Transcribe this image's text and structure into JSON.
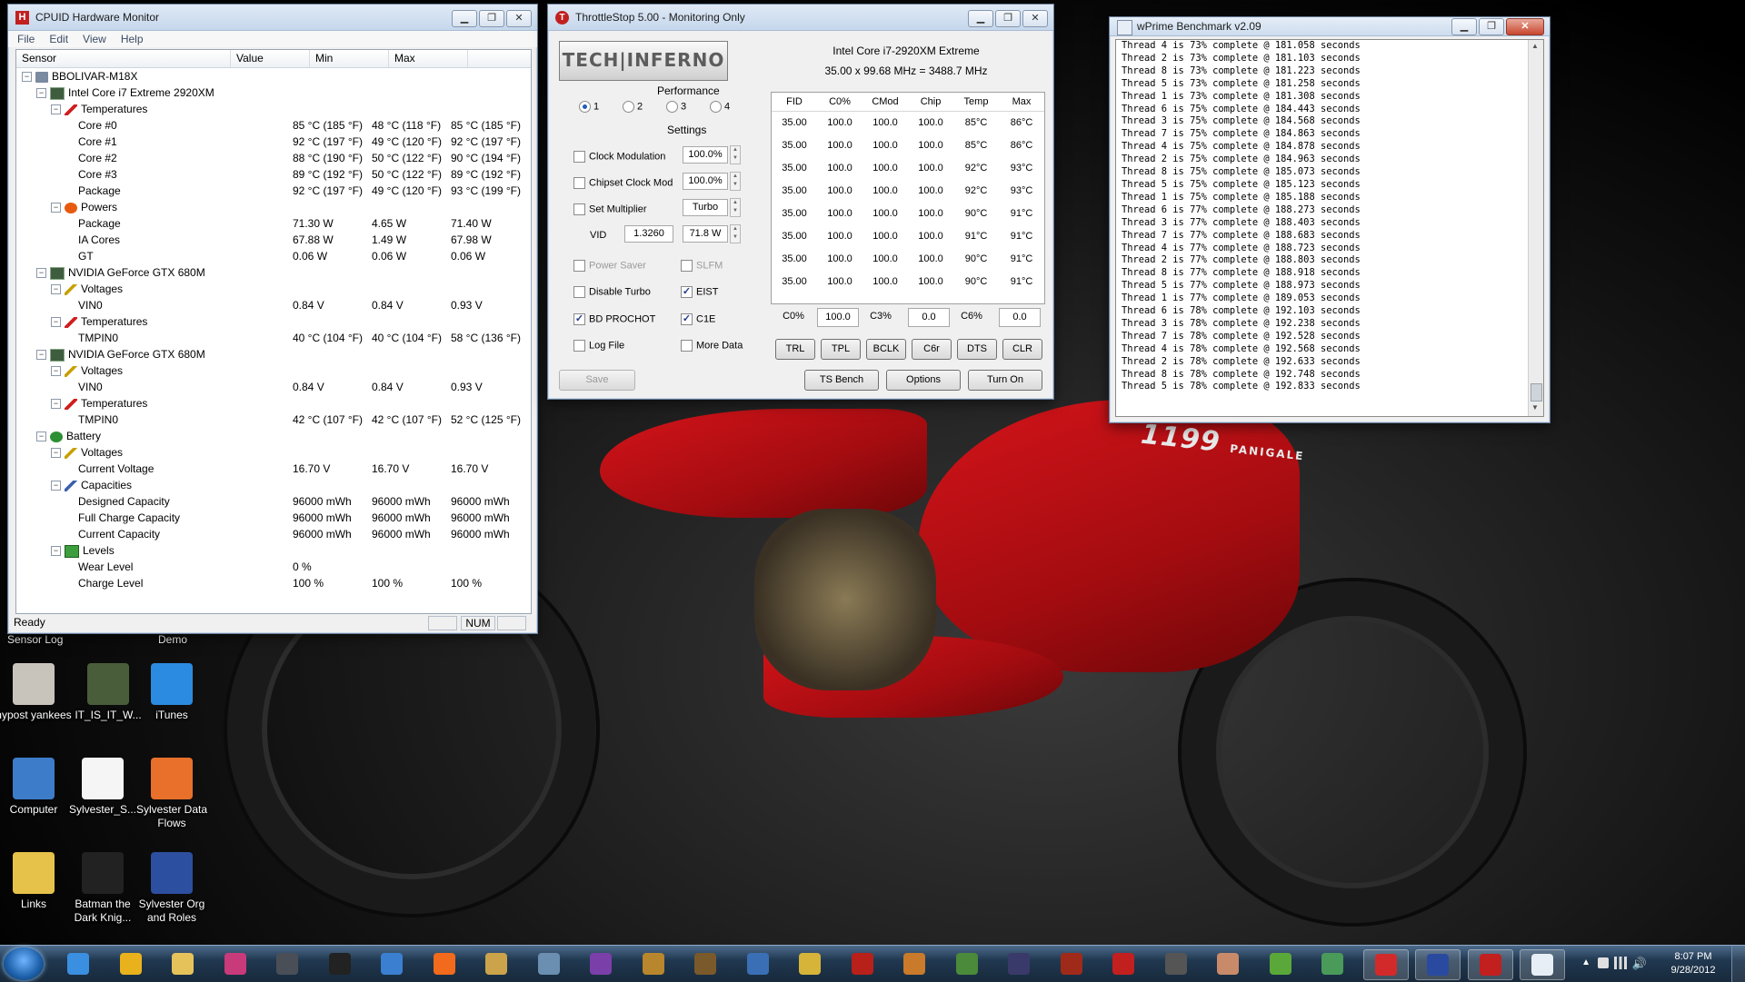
{
  "hwm": {
    "title": "CPUID Hardware Monitor",
    "menu": [
      "File",
      "Edit",
      "View",
      "Help"
    ],
    "columns": [
      "Sensor",
      "Value",
      "Min",
      "Max"
    ],
    "status": "Ready",
    "num": "NUM",
    "rows": [
      {
        "indent": 0,
        "exp": "−",
        "icon": "pc",
        "label": "BBOLIVAR-M18X",
        "v": "",
        "mn": "",
        "mx": ""
      },
      {
        "indent": 1,
        "exp": "−",
        "icon": "chip",
        "label": "Intel Core i7 Extreme 2920XM",
        "v": "",
        "mn": "",
        "mx": ""
      },
      {
        "indent": 2,
        "exp": "−",
        "icon": "therm",
        "label": "Temperatures",
        "v": "",
        "mn": "",
        "mx": ""
      },
      {
        "indent": 3,
        "exp": "",
        "icon": "",
        "label": "Core #0",
        "v": "85 °C  (185 °F)",
        "mn": "48 °C  (118 °F)",
        "mx": "85 °C  (185 °F)"
      },
      {
        "indent": 3,
        "exp": "",
        "icon": "",
        "label": "Core #1",
        "v": "92 °C  (197 °F)",
        "mn": "49 °C  (120 °F)",
        "mx": "92 °C  (197 °F)"
      },
      {
        "indent": 3,
        "exp": "",
        "icon": "",
        "label": "Core #2",
        "v": "88 °C  (190 °F)",
        "mn": "50 °C  (122 °F)",
        "mx": "90 °C  (194 °F)"
      },
      {
        "indent": 3,
        "exp": "",
        "icon": "",
        "label": "Core #3",
        "v": "89 °C  (192 °F)",
        "mn": "50 °C  (122 °F)",
        "mx": "89 °C  (192 °F)"
      },
      {
        "indent": 3,
        "exp": "",
        "icon": "",
        "label": "Package",
        "v": "92 °C  (197 °F)",
        "mn": "49 °C  (120 °F)",
        "mx": "93 °C  (199 °F)"
      },
      {
        "indent": 2,
        "exp": "−",
        "icon": "bolt",
        "label": "Powers",
        "v": "",
        "mn": "",
        "mx": ""
      },
      {
        "indent": 3,
        "exp": "",
        "icon": "",
        "label": "Package",
        "v": "71.30 W",
        "mn": "4.65 W",
        "mx": "71.40 W"
      },
      {
        "indent": 3,
        "exp": "",
        "icon": "",
        "label": "IA Cores",
        "v": "67.88 W",
        "mn": "1.49 W",
        "mx": "67.98 W"
      },
      {
        "indent": 3,
        "exp": "",
        "icon": "",
        "label": "GT",
        "v": "0.06 W",
        "mn": "0.06 W",
        "mx": "0.06 W"
      },
      {
        "indent": 1,
        "exp": "−",
        "icon": "chip",
        "label": "NVIDIA GeForce GTX 680M",
        "v": "",
        "mn": "",
        "mx": ""
      },
      {
        "indent": 2,
        "exp": "−",
        "icon": "volt",
        "label": "Voltages",
        "v": "",
        "mn": "",
        "mx": ""
      },
      {
        "indent": 3,
        "exp": "",
        "icon": "",
        "label": "VIN0",
        "v": "0.84 V",
        "mn": "0.84 V",
        "mx": "0.93 V"
      },
      {
        "indent": 2,
        "exp": "−",
        "icon": "therm",
        "label": "Temperatures",
        "v": "",
        "mn": "",
        "mx": ""
      },
      {
        "indent": 3,
        "exp": "",
        "icon": "",
        "label": "TMPIN0",
        "v": "40 °C  (104 °F)",
        "mn": "40 °C  (104 °F)",
        "mx": "58 °C  (136 °F)"
      },
      {
        "indent": 1,
        "exp": "−",
        "icon": "chip",
        "label": "NVIDIA GeForce GTX 680M",
        "v": "",
        "mn": "",
        "mx": ""
      },
      {
        "indent": 2,
        "exp": "−",
        "icon": "volt",
        "label": "Voltages",
        "v": "",
        "mn": "",
        "mx": ""
      },
      {
        "indent": 3,
        "exp": "",
        "icon": "",
        "label": "VIN0",
        "v": "0.84 V",
        "mn": "0.84 V",
        "mx": "0.93 V"
      },
      {
        "indent": 2,
        "exp": "−",
        "icon": "therm",
        "label": "Temperatures",
        "v": "",
        "mn": "",
        "mx": ""
      },
      {
        "indent": 3,
        "exp": "",
        "icon": "",
        "label": "TMPIN0",
        "v": "42 °C  (107 °F)",
        "mn": "42 °C  (107 °F)",
        "mx": "52 °C  (125 °F)"
      },
      {
        "indent": 1,
        "exp": "−",
        "icon": "bat",
        "label": "Battery",
        "v": "",
        "mn": "",
        "mx": ""
      },
      {
        "indent": 2,
        "exp": "−",
        "icon": "volt",
        "label": "Voltages",
        "v": "",
        "mn": "",
        "mx": ""
      },
      {
        "indent": 3,
        "exp": "",
        "icon": "",
        "label": "Current Voltage",
        "v": "16.70 V",
        "mn": "16.70 V",
        "mx": "16.70 V"
      },
      {
        "indent": 2,
        "exp": "−",
        "icon": "cap",
        "label": "Capacities",
        "v": "",
        "mn": "",
        "mx": ""
      },
      {
        "indent": 3,
        "exp": "",
        "icon": "",
        "label": "Designed Capacity",
        "v": "96000 mWh",
        "mn": "96000 mWh",
        "mx": "96000 mWh"
      },
      {
        "indent": 3,
        "exp": "",
        "icon": "",
        "label": "Full Charge Capacity",
        "v": "96000 mWh",
        "mn": "96000 mWh",
        "mx": "96000 mWh"
      },
      {
        "indent": 3,
        "exp": "",
        "icon": "",
        "label": "Current Capacity",
        "v": "96000 mWh",
        "mn": "96000 mWh",
        "mx": "96000 mWh"
      },
      {
        "indent": 2,
        "exp": "−",
        "icon": "lvl",
        "label": "Levels",
        "v": "",
        "mn": "",
        "mx": ""
      },
      {
        "indent": 3,
        "exp": "",
        "icon": "",
        "label": "Wear Level",
        "v": "0 %",
        "mn": "",
        "mx": ""
      },
      {
        "indent": 3,
        "exp": "",
        "icon": "",
        "label": "Charge Level",
        "v": "100 %",
        "mn": "100 %",
        "mx": "100 %"
      }
    ]
  },
  "ts": {
    "title": "ThrottleStop 5.00 - Monitoring Only",
    "logo": "TECH|INFERNO",
    "cpu_name": "Intel Core i7-2920XM Extreme",
    "cpu_clock": "35.00 x 99.68 MHz = 3488.7 MHz",
    "performance_label": "Performance",
    "profiles": [
      "1",
      "2",
      "3",
      "4"
    ],
    "settings_label": "Settings",
    "clock_mod_label": "Clock Modulation",
    "clock_mod_value": "100.0%",
    "chipset_label": "Chipset Clock Mod",
    "chipset_value": "100.0%",
    "set_mult_label": "Set Multiplier",
    "set_mult_value": "Turbo",
    "vid_label": "VID",
    "vid_value": "1.3260",
    "vid_watts": "71.8 W",
    "power_saver": "Power Saver",
    "slfm": "SLFM",
    "disable_turbo": "Disable Turbo",
    "eist": "EIST",
    "bd_prochot": "BD PROCHOT",
    "c1e": "C1E",
    "log_file": "Log File",
    "more_data": "More Data",
    "grid_headers": [
      "FID",
      "C0%",
      "CMod",
      "Chip",
      "Temp",
      "Max"
    ],
    "grid_rows": [
      [
        "35.00",
        "100.0",
        "100.0",
        "100.0",
        "85°C",
        "86°C"
      ],
      [
        "35.00",
        "100.0",
        "100.0",
        "100.0",
        "85°C",
        "86°C"
      ],
      [
        "35.00",
        "100.0",
        "100.0",
        "100.0",
        "92°C",
        "93°C"
      ],
      [
        "35.00",
        "100.0",
        "100.0",
        "100.0",
        "92°C",
        "93°C"
      ],
      [
        "35.00",
        "100.0",
        "100.0",
        "100.0",
        "90°C",
        "91°C"
      ],
      [
        "35.00",
        "100.0",
        "100.0",
        "100.0",
        "91°C",
        "91°C"
      ],
      [
        "35.00",
        "100.0",
        "100.0",
        "100.0",
        "90°C",
        "91°C"
      ],
      [
        "35.00",
        "100.0",
        "100.0",
        "100.0",
        "90°C",
        "91°C"
      ]
    ],
    "c0_label": "C0%",
    "c0_value": "100.0",
    "c3_label": "C3%",
    "c3_value": "0.0",
    "c6_label": "C6%",
    "c6_value": "0.0",
    "buttons": [
      "TRL",
      "TPL",
      "BCLK",
      "C6r",
      "DTS",
      "CLR"
    ],
    "save": "Save",
    "ts_bench": "TS Bench",
    "options": "Options",
    "turn_on": "Turn On"
  },
  "wp": {
    "title": "wPrime Benchmark v2.09",
    "lines": [
      "Thread 4 is 73% complete @ 181.058 seconds",
      "Thread 2 is 73% complete @ 181.103 seconds",
      "Thread 8 is 73% complete @ 181.223 seconds",
      "Thread 5 is 73% complete @ 181.258 seconds",
      "Thread 1 is 73% complete @ 181.308 seconds",
      "Thread 6 is 75% complete @ 184.443 seconds",
      "Thread 3 is 75% complete @ 184.568 seconds",
      "Thread 7 is 75% complete @ 184.863 seconds",
      "Thread 4 is 75% complete @ 184.878 seconds",
      "Thread 2 is 75% complete @ 184.963 seconds",
      "Thread 8 is 75% complete @ 185.073 seconds",
      "Thread 5 is 75% complete @ 185.123 seconds",
      "Thread 1 is 75% complete @ 185.188 seconds",
      "Thread 6 is 77% complete @ 188.273 seconds",
      "Thread 3 is 77% complete @ 188.403 seconds",
      "Thread 7 is 77% complete @ 188.683 seconds",
      "Thread 4 is 77% complete @ 188.723 seconds",
      "Thread 2 is 77% complete @ 188.803 seconds",
      "Thread 8 is 77% complete @ 188.918 seconds",
      "Thread 5 is 77% complete @ 188.973 seconds",
      "Thread 1 is 77% complete @ 189.053 seconds",
      "Thread 6 is 78% complete @ 192.103 seconds",
      "Thread 3 is 78% complete @ 192.238 seconds",
      "Thread 7 is 78% complete @ 192.528 seconds",
      "Thread 4 is 78% complete @ 192.568 seconds",
      "Thread 2 is 78% complete @ 192.633 seconds",
      "Thread 8 is 78% complete @ 192.748 seconds",
      "Thread 5 is 78% complete @ 192.833 seconds"
    ]
  },
  "desktop": {
    "top_labels": [
      "Sensor Log",
      "Demo"
    ],
    "icons": [
      {
        "label": "nypost yankees",
        "color": "#c9c4bb"
      },
      {
        "label": "IT_IS_IT_W...",
        "color": "#4a5d3a"
      },
      {
        "label": "iTunes",
        "color": "#2b8be0"
      },
      {
        "label": "Computer",
        "color": "#3d7cc9"
      },
      {
        "label": "Sylvester_S...",
        "color": "#f5f5f5"
      },
      {
        "label": "Sylvester Data Flows",
        "color": "#e8702a"
      },
      {
        "label": "Links",
        "color": "#e6c24a"
      },
      {
        "label": "Batman the Dark Knig...",
        "color": "#222222"
      },
      {
        "label": "Sylvester Org and Roles",
        "color": "#2d4fa0"
      }
    ],
    "bike_model": "1199",
    "bike_name": "PANIGALE"
  },
  "taskbar": {
    "time": "8:07 PM",
    "date": "9/28/2012",
    "apps": [
      {
        "name": "ie-icon",
        "color": "#3a8fe0"
      },
      {
        "name": "chrome-icon",
        "color": "#e9b21d"
      },
      {
        "name": "explorer-icon",
        "color": "#e6c35a"
      },
      {
        "name": "app-icon",
        "color": "#c93a7a"
      },
      {
        "name": "steam-icon",
        "color": "#4a4f57"
      },
      {
        "name": "gpu-icon",
        "color": "#222222"
      },
      {
        "name": "windows-icon",
        "color": "#3b7fd0"
      },
      {
        "name": "origin-icon",
        "color": "#f26a1b"
      },
      {
        "name": "game-icon",
        "color": "#caa34a"
      },
      {
        "name": "starcraft-icon",
        "color": "#6a8fb0"
      },
      {
        "name": "onenote-icon",
        "color": "#7a3fa8"
      },
      {
        "name": "wow-icon",
        "color": "#b8862c"
      },
      {
        "name": "game-icon",
        "color": "#7a5a2a"
      },
      {
        "name": "game-icon",
        "color": "#3a6fb5"
      },
      {
        "name": "game-icon",
        "color": "#d6b43a"
      },
      {
        "name": "game-icon",
        "color": "#b8201a"
      },
      {
        "name": "game-icon",
        "color": "#c97a2a"
      },
      {
        "name": "game-icon",
        "color": "#4a8a3a"
      },
      {
        "name": "game-icon",
        "color": "#3a3a6a"
      },
      {
        "name": "diablo-icon",
        "color": "#a02a1a"
      },
      {
        "name": "cpuid-icon",
        "color": "#c21f1f"
      },
      {
        "name": "game-icon",
        "color": "#555555"
      },
      {
        "name": "game-icon",
        "color": "#c98a6a"
      },
      {
        "name": "xbox-icon",
        "color": "#5aa83a"
      },
      {
        "name": "map-icon",
        "color": "#4a9a5a"
      },
      {
        "name": "flash-icon",
        "color": "#d22a2a"
      },
      {
        "name": "hwmonitor-icon",
        "color": "#2a4aa0"
      },
      {
        "name": "throttlestop-icon",
        "color": "#c21f1f"
      },
      {
        "name": "wprime-icon",
        "color": "#e8eef6"
      }
    ]
  }
}
